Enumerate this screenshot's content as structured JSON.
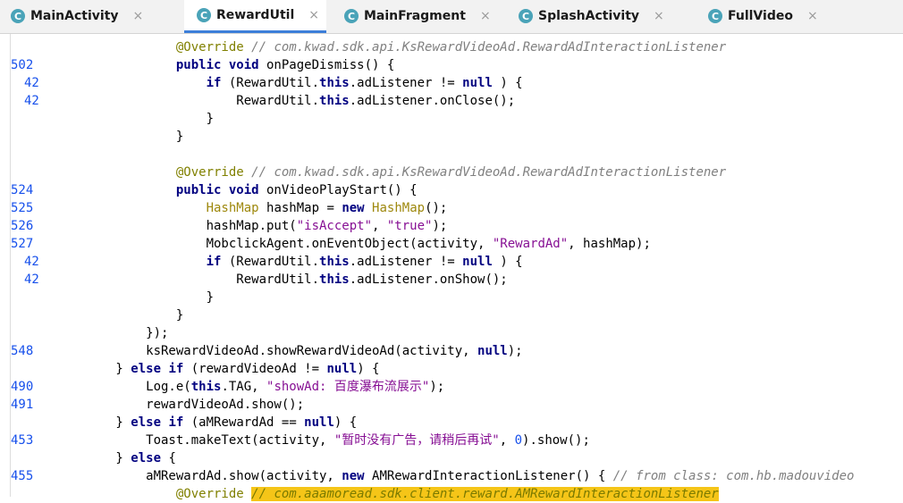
{
  "tabs": [
    {
      "label": "MainActivity",
      "icon": "class-icon",
      "active": false
    },
    {
      "label": "RewardUtil",
      "icon": "class-icon",
      "active": true
    },
    {
      "label": "MainFragment",
      "icon": "class-icon",
      "active": false
    },
    {
      "label": "SplashActivity",
      "icon": "class-icon",
      "active": false
    },
    {
      "label": "FullVideo",
      "icon": "class-icon",
      "active": false
    }
  ],
  "close_glyph": "×",
  "class_glyph": "C",
  "lines": [
    {
      "n": "",
      "t": [
        [
          "an",
          "                @Override "
        ],
        [
          "cm",
          "// com.kwad.sdk.api.KsRewardVideoAd.RewardAdInteractionListener"
        ]
      ]
    },
    {
      "n": "502",
      "t": [
        [
          "",
          "                "
        ],
        [
          "k",
          "public void"
        ],
        [
          "",
          " onPageDismiss() {"
        ]
      ]
    },
    {
      "n": "42",
      "t": [
        [
          "",
          "                    "
        ],
        [
          "k",
          "if"
        ],
        [
          "",
          " (RewardUtil."
        ],
        [
          "k",
          "this"
        ],
        [
          "",
          ".adListener != "
        ],
        [
          "k",
          "null"
        ],
        [
          "",
          " ) {"
        ]
      ]
    },
    {
      "n": "42",
      "t": [
        [
          "",
          "                        RewardUtil."
        ],
        [
          "k",
          "this"
        ],
        [
          "",
          ".adListener.onClose();"
        ]
      ]
    },
    {
      "n": "",
      "t": [
        [
          "",
          "                    }"
        ]
      ]
    },
    {
      "n": "",
      "t": [
        [
          "",
          "                }"
        ]
      ]
    },
    {
      "n": "",
      "t": [
        [
          "",
          ""
        ]
      ]
    },
    {
      "n": "",
      "t": [
        [
          "an",
          "                @Override "
        ],
        [
          "cm",
          "// com.kwad.sdk.api.KsRewardVideoAd.RewardAdInteractionListener"
        ]
      ]
    },
    {
      "n": "524",
      "t": [
        [
          "",
          "                "
        ],
        [
          "k",
          "public void"
        ],
        [
          "",
          " onVideoPlayStart() {"
        ]
      ]
    },
    {
      "n": "525",
      "t": [
        [
          "",
          "                    "
        ],
        [
          "ty",
          "HashMap"
        ],
        [
          "",
          " hashMap = "
        ],
        [
          "k",
          "new"
        ],
        [
          "",
          " "
        ],
        [
          "ty",
          "HashMap"
        ],
        [
          "",
          "();"
        ]
      ]
    },
    {
      "n": "526",
      "t": [
        [
          "",
          "                    hashMap.put("
        ],
        [
          "sp",
          "\"isAccept\""
        ],
        [
          "",
          ", "
        ],
        [
          "sp",
          "\"true\""
        ],
        [
          "",
          ");"
        ]
      ]
    },
    {
      "n": "527",
      "t": [
        [
          "",
          "                    MobclickAgent.onEventObject(activity, "
        ],
        [
          "sp",
          "\"RewardAd\""
        ],
        [
          "",
          ", hashMap);"
        ]
      ]
    },
    {
      "n": "42",
      "t": [
        [
          "",
          "                    "
        ],
        [
          "k",
          "if"
        ],
        [
          "",
          " (RewardUtil."
        ],
        [
          "k",
          "this"
        ],
        [
          "",
          ".adListener != "
        ],
        [
          "k",
          "null"
        ],
        [
          "",
          " ) {"
        ]
      ]
    },
    {
      "n": "42",
      "t": [
        [
          "",
          "                        RewardUtil."
        ],
        [
          "k",
          "this"
        ],
        [
          "",
          ".adListener.onShow();"
        ]
      ]
    },
    {
      "n": "",
      "t": [
        [
          "",
          "                    }"
        ]
      ]
    },
    {
      "n": "",
      "t": [
        [
          "",
          "                }"
        ]
      ]
    },
    {
      "n": "",
      "t": [
        [
          "",
          "            });"
        ]
      ]
    },
    {
      "n": "548",
      "t": [
        [
          "",
          "            ksRewardVideoAd.showRewardVideoAd(activity, "
        ],
        [
          "k",
          "null"
        ],
        [
          "",
          ");"
        ]
      ]
    },
    {
      "n": "",
      "t": [
        [
          "",
          "        } "
        ],
        [
          "k",
          "else if"
        ],
        [
          "",
          " (rewardVideoAd != "
        ],
        [
          "k",
          "null"
        ],
        [
          "",
          ") {"
        ]
      ]
    },
    {
      "n": "490",
      "t": [
        [
          "",
          "            Log.e("
        ],
        [
          "k",
          "this"
        ],
        [
          "",
          ".TAG, "
        ],
        [
          "sp",
          "\"showAd: 百度瀑布流展示\""
        ],
        [
          "",
          ");"
        ]
      ]
    },
    {
      "n": "491",
      "t": [
        [
          "",
          "            rewardVideoAd.show();"
        ]
      ]
    },
    {
      "n": "",
      "t": [
        [
          "",
          "        } "
        ],
        [
          "k",
          "else if"
        ],
        [
          "",
          " (aMRewardAd == "
        ],
        [
          "k",
          "null"
        ],
        [
          "",
          ") {"
        ]
      ]
    },
    {
      "n": "453",
      "t": [
        [
          "",
          "            Toast.makeText(activity, "
        ],
        [
          "sp",
          "\"暂时没有广告，请稍后再试\""
        ],
        [
          "",
          ", "
        ],
        [
          "num",
          "0"
        ],
        [
          "",
          ").show();"
        ]
      ]
    },
    {
      "n": "",
      "t": [
        [
          "",
          "        } "
        ],
        [
          "k",
          "else"
        ],
        [
          "",
          " {"
        ]
      ]
    },
    {
      "n": "455",
      "t": [
        [
          "",
          "            aMRewardAd.show(activity, "
        ],
        [
          "k",
          "new"
        ],
        [
          "",
          " AMRewardInteractionListener() { "
        ],
        [
          "cm",
          "// from class: com.hb.madouvideo"
        ]
      ]
    },
    {
      "n": "",
      "t": [
        [
          "an",
          "                @Override "
        ],
        [
          "cmb",
          "// com.aaamoread.sdk.client.reward.AMRewardInteractionListener"
        ]
      ]
    }
  ]
}
